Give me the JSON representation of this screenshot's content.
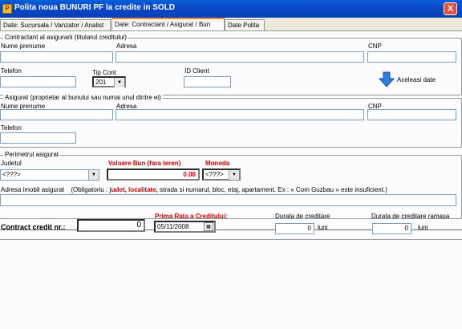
{
  "window": {
    "title": "Polita noua BUNURI PF la credite in SOLD",
    "close_glyph": "X"
  },
  "tabs": [
    {
      "label": "Date: Sucursala / Vanzator / Analist"
    },
    {
      "label": "Date: Contractant / Asigurat / Bun"
    },
    {
      "label": "Date Polita"
    }
  ],
  "contractant": {
    "legend": "Contractant al asigurarii  (titularul creditului)",
    "nume_label": "Nume prenume",
    "adresa_label": "Adresa",
    "cnp_label": "CNP",
    "telefon_label": "Telefon",
    "tip_cont_label": "Tip Cont",
    "tip_cont_value": "201",
    "id_client_label": "ID Client",
    "aceleasi_label": "Aceleasi date"
  },
  "asigurat": {
    "legend": "Asigurat (proprietar al bunului sau numai unul dintre ei)",
    "nume_label": "Nume prenume",
    "adresa_label": "Adresa",
    "cnp_label": "CNP",
    "telefon_label": "Telefon"
  },
  "perimetru": {
    "legend": "Perimetrul asigurat",
    "judet_label": "Judetul",
    "judet_value": "<???>",
    "valoare_label": "Valoare Bun (fara teren)",
    "valoare_value": "0.00",
    "moneda_label": "Moneda",
    "moneda_value": "<???>",
    "adresa_label": "Adresa imobil asigurat",
    "hint_prefix": "(Obligatoriu : ",
    "hint_bold": "judet, localitate,",
    "hint_suffix": " strada si numarul, bloc, etaj, apartament. Ex : « Com Guzbau » este insuficient.)"
  },
  "credit": {
    "contract_label": "Contract credit nr.:",
    "contract_value": "0",
    "prima_rata_label": "Prima Rata a Creditului:",
    "prima_rata_value": "05/11/2008",
    "durata_label": "Durata de creditare",
    "durata_value": "0",
    "durata_unit": "luni",
    "durata_ramasa_label": "Durata de creditare ramasa",
    "durata_ramasa_value": "0",
    "durata_ramasa_unit": "luni"
  },
  "colors": {
    "accent_red": "#d00000",
    "title_blue": "#0a48c8",
    "arrow_blue": "#2f7fe0"
  },
  "icons": {
    "title": "app-icon",
    "arrow": "arrow-down-icon",
    "calendar": "calendar-icon"
  }
}
